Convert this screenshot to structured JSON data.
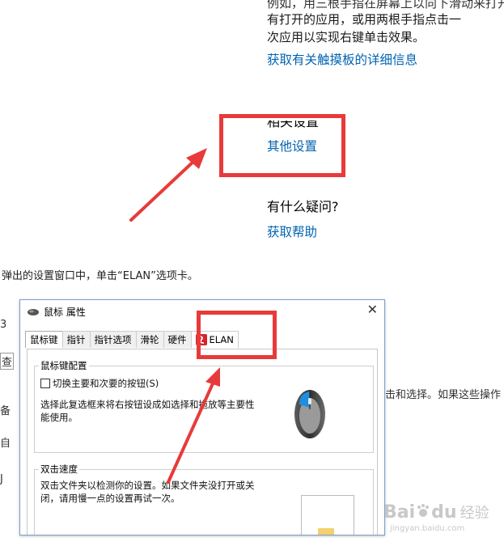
{
  "settings": {
    "desc_line0": "例如，用三根手指在屏幕上以向下滑动来打开",
    "desc_line1": "有打开的应用，或用两根手指点击一",
    "desc_line2": "次应用以实现右键单击效果。",
    "touchpad_link": "获取有关触摸板的详细信息",
    "related_heading": "相关设置",
    "other_settings_link": "其他设置",
    "question_heading": "有什么疑问?",
    "help_link": "获取帮助"
  },
  "caption": "弹出的设置窗口中，单击“ELAN”选项卡。",
  "dialog": {
    "title": "鼠标 属性",
    "close": "✕",
    "tabs": [
      "鼠标键",
      "指针",
      "指针选项",
      "滑轮",
      "硬件",
      "ELAN"
    ],
    "button_config": {
      "label": "鼠标键配置",
      "checkbox_label": "切换主要和次要的按钮(S)",
      "description_line1": "选择此复选框来将右按钮设成如选择和拖放等主要性",
      "description_line2": "能使用。"
    },
    "double_click": {
      "label": "双击速度",
      "description_line1": "双击文件夹以检测你的设置。如果文件夹没打开或关",
      "description_line2": "闭，请用慢一点的设置再试一次。"
    }
  },
  "side_fragments": {
    "right": "击和选择。如果这些操作",
    "left1": "3",
    "left2": "查",
    "left3": "备",
    "left4": "自",
    "left5": "J"
  },
  "watermark": {
    "brand": "Bai",
    "brand2": "du",
    "suffix": "经验",
    "url": "jingyan.baidu.com"
  },
  "colors": {
    "link": "#0063b1",
    "highlight": "#e83a3a",
    "accent_arrow": "#e83a3a"
  }
}
